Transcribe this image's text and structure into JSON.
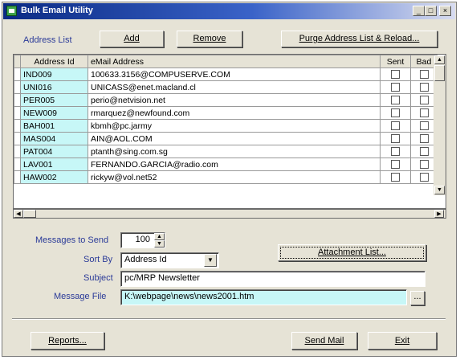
{
  "window": {
    "title": "Bulk Email Utility"
  },
  "title_controls": [
    "_",
    "□",
    "×"
  ],
  "address_list": {
    "label": "Address List",
    "add_label": "Add",
    "remove_label": "Remove",
    "purge_label": "Purge Address List & Reload..."
  },
  "table": {
    "columns": [
      "Address Id",
      "eMail Address",
      "Sent",
      "Bad"
    ],
    "rows": [
      {
        "id": "IND009",
        "email": "100633.3156@COMPUSERVE.COM"
      },
      {
        "id": "UNI016",
        "email": "UNICASS@enet.macland.cl"
      },
      {
        "id": "PER005",
        "email": "perio@netvision.net"
      },
      {
        "id": "NEW009",
        "email": "rmarquez@newfound.com"
      },
      {
        "id": "BAH001",
        "email": "kbmh@pc.jarmy"
      },
      {
        "id": "MAS004",
        "email": "AIN@AOL.COM"
      },
      {
        "id": "PAT004",
        "email": "ptanth@sing.com.sg"
      },
      {
        "id": "LAV001",
        "email": "FERNANDO.GARCIA@radio.com"
      },
      {
        "id": "HAW002",
        "email": "rickyw@vol.net52"
      }
    ]
  },
  "form": {
    "messages_label": "Messages to Send",
    "messages_value": "100",
    "sortby_label": "Sort By",
    "sortby_value": "Address Id",
    "subject_label": "Subject",
    "subject_value": "pc/MRP Newsletter",
    "file_label": "Message File",
    "file_value": "K:\\webpage\\news\\news2001.htm",
    "attachment_label": "Attachment List...",
    "browse_label": "..."
  },
  "footer": {
    "reports_label": "Reports...",
    "send_label": "Send Mail",
    "exit_label": "Exit"
  }
}
